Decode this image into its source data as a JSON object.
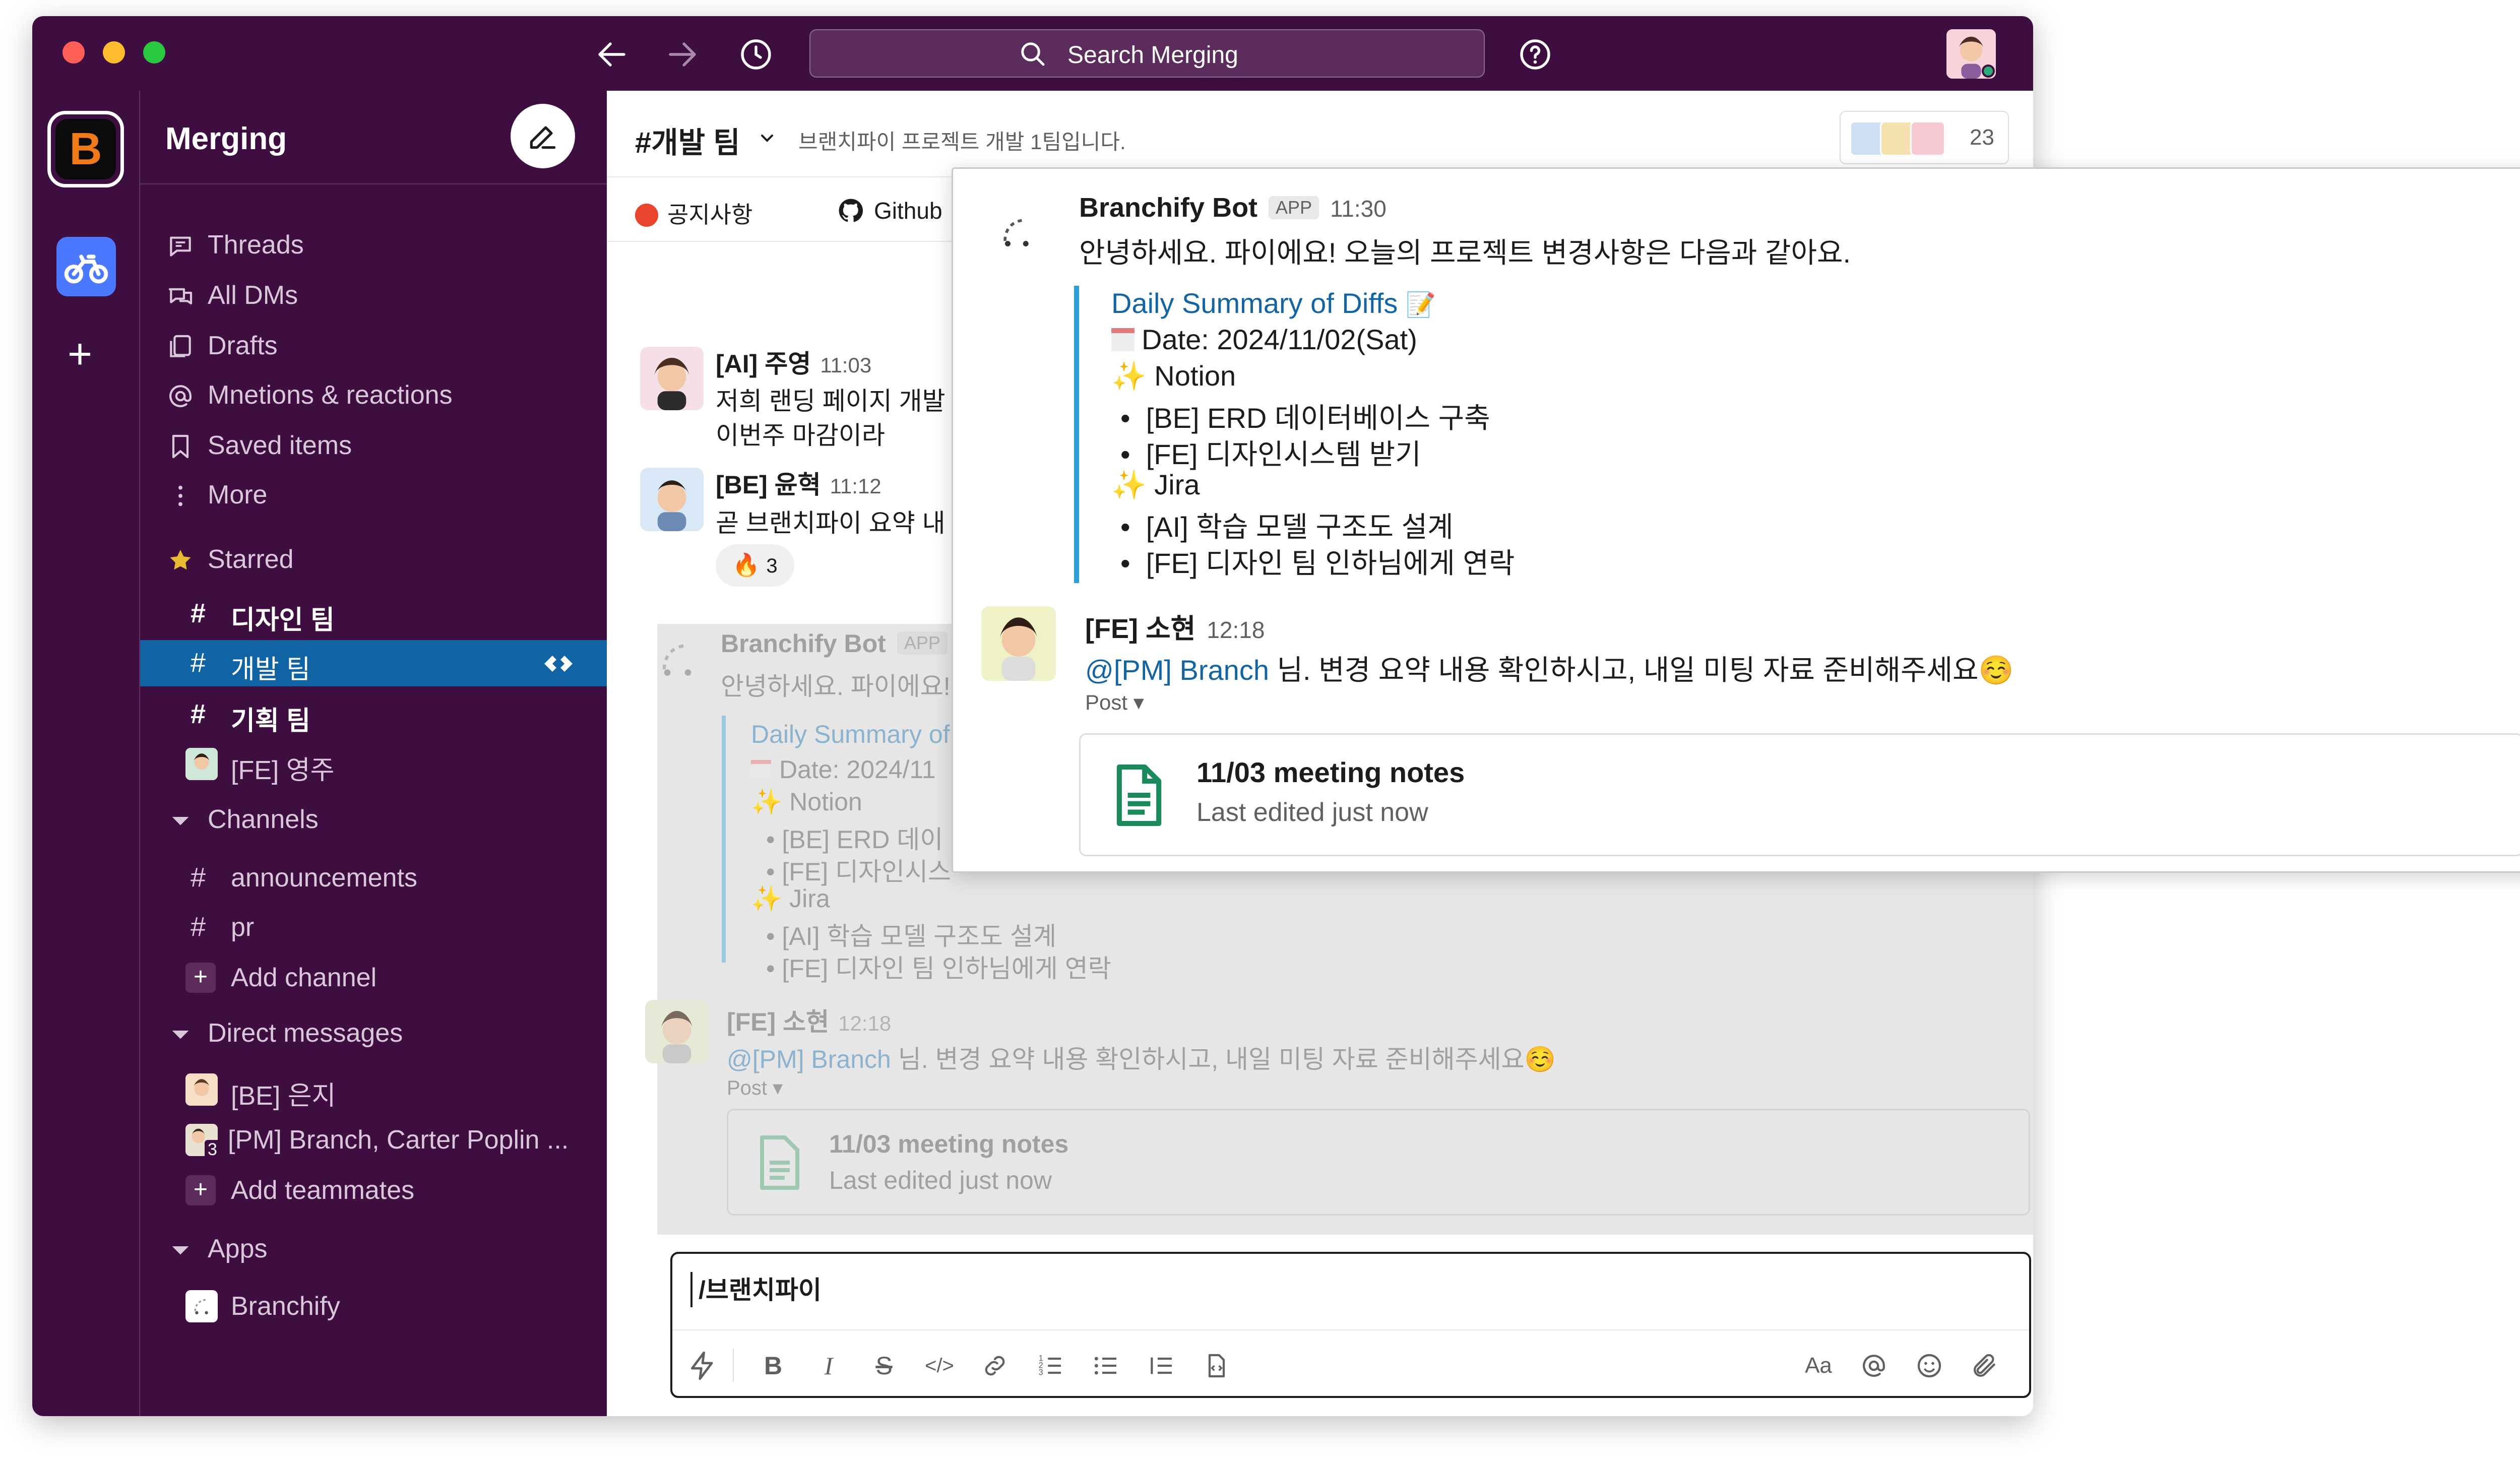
{
  "titlebar": {
    "search_placeholder": "Search Merging"
  },
  "workspace": {
    "initial": "B",
    "name": "Merging"
  },
  "sidebar": {
    "nav": [
      {
        "label": "Threads",
        "icon": "threads-icon"
      },
      {
        "label": "All DMs",
        "icon": "dms-icon"
      },
      {
        "label": "Drafts",
        "icon": "drafts-icon"
      },
      {
        "label": "Mnetions & reactions",
        "icon": "mentions-icon"
      },
      {
        "label": "Saved items",
        "icon": "bookmark-icon"
      },
      {
        "label": "More",
        "icon": "more-icon"
      }
    ],
    "starred_label": "Starred",
    "starred": [
      {
        "label": "디자인 팀"
      },
      {
        "label": "개발 팀"
      },
      {
        "label": "기획 팀"
      },
      {
        "label": "[FE] 영주"
      }
    ],
    "channels_label": "Channels",
    "channels": [
      {
        "label": "announcements"
      },
      {
        "label": "pr"
      }
    ],
    "add_channel": "Add channel",
    "dms_label": "Direct messages",
    "dms": [
      {
        "label": "[BE] 은지"
      },
      {
        "label": "[PM] Branch, Carter Poplin ...",
        "badge": "3"
      }
    ],
    "add_teammates": "Add teammates",
    "apps_label": "Apps",
    "apps": [
      {
        "label": "Branchify"
      }
    ]
  },
  "channel": {
    "title": "#개발 팀",
    "description": "브랜치파이 프로젝트 개발 1팀입니다.",
    "member_count": "23",
    "bookmarks": [
      {
        "label": "공지사항"
      },
      {
        "label": "Github"
      }
    ]
  },
  "messages": [
    {
      "name": "[AI] 주영",
      "time": "11:03",
      "lines": [
        "저희 랜딩 페이지 개발",
        "이번주 마감이라"
      ]
    },
    {
      "name": "[BE] 윤혁",
      "time": "11:12",
      "lines": [
        "곧 브랜치파이 요약 내"
      ],
      "reaction": {
        "emoji": "🔥",
        "count": "3"
      }
    },
    {
      "name": "Branchify Bot",
      "badge": "APP",
      "time": "",
      "lines": [
        "안녕하세요. 파이에요!"
      ],
      "summary": {
        "title": "Daily Summary of",
        "date": "Date: 2024/11",
        "notion": "Notion",
        "items_notion": [
          "[BE] ERD 데이",
          "[FE] 디자인시스"
        ],
        "jira": "Jira",
        "items_jira": [
          "[AI] 학습 모델 구조도 설계",
          "[FE] 디자인 팀 인하님에게 연락"
        ]
      }
    },
    {
      "name": "[FE] 소현",
      "time": "12:18",
      "mention": "@[PM] Branch",
      "text": " 님. 변경 요약 내용 확인하시고, 내일 미팅 자료 준비해주세요☺️",
      "post_label": "Post",
      "post": {
        "title": "11/03 meeting notes",
        "subtitle": "Last edited just now"
      }
    }
  ],
  "composer": {
    "text": "/브랜치파이"
  },
  "popup": {
    "bot": {
      "name": "Branchify Bot",
      "badge": "APP",
      "time": "11:30",
      "intro": "안녕하세요. 파이에요! 오늘의 프로젝트 변경사항은 다음과 같아요.",
      "summary_title": "Daily Summary of Diffs",
      "date": "Date: 2024/11/02(Sat)",
      "notion": "Notion",
      "notion_items": [
        "[BE] ERD 데이터베이스 구축",
        "[FE] 디자인시스템 받기"
      ],
      "jira": "Jira",
      "jira_items": [
        "[AI] 학습 모델 구조도 설계",
        "[FE] 디자인 팀 인하님에게 연락"
      ]
    },
    "reply": {
      "name": "[FE] 소현",
      "time": "12:18",
      "mention": "@[PM] Branch",
      "text": " 님. 변경 요약 내용 확인하시고, 내일 미팅 자료 준비해주세요☺️",
      "post_label": "Post",
      "post_title": "11/03 meeting notes",
      "post_subtitle": "Last edited just now"
    }
  },
  "colors": {
    "aubergine": "#3f0e40",
    "active_channel": "#1164a3",
    "quote_bar": "#2b9dd8",
    "link": "#1264a3",
    "online": "#2bac76"
  }
}
